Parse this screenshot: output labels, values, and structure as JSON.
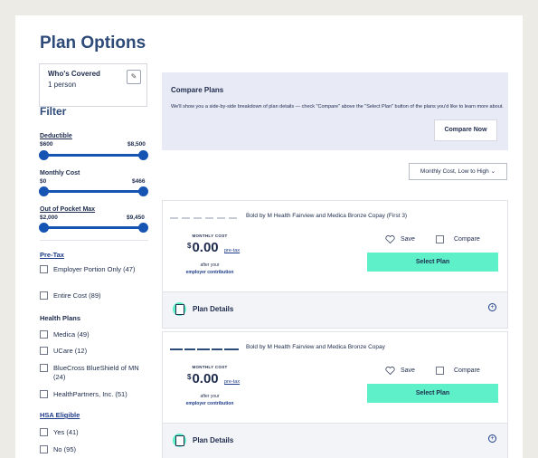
{
  "header": {
    "title": "Plan Options"
  },
  "covered": {
    "label": "Who's Covered",
    "value": "1 person",
    "edit_icon": "pencil-icon"
  },
  "filter": {
    "title": "Filter",
    "sliders": [
      {
        "label": "Deductible",
        "min": "$600",
        "max": "$8,500",
        "low_pct": 0,
        "high_pct": 100
      },
      {
        "label": "Monthly Cost",
        "min": "$0",
        "max": "$466",
        "low_pct": 0,
        "high_pct": 100
      },
      {
        "label": "Out of Pocket Max",
        "min": "$2,000",
        "max": "$9,450",
        "low_pct": 0,
        "high_pct": 100
      }
    ],
    "pretax": {
      "title": "Pre-Tax",
      "options": [
        "Employer Portion Only (47)",
        "Entire Cost (89)"
      ]
    },
    "health_plans": {
      "title": "Health Plans",
      "options": [
        "Medica (49)",
        "UCare (12)",
        "BlueCross BlueShield of MN (24)",
        "HealthPartners, Inc. (51)"
      ]
    },
    "hsa": {
      "title": "HSA Eligible",
      "options": [
        "Yes (41)",
        "No (95)"
      ]
    }
  },
  "compare": {
    "title": "Compare Plans",
    "desc": "We'll show you a side-by-side breakdown of plan details — check \"Compare\" above the \"Select Plan\" button of the plans you'd like to learn more about.",
    "button": "Compare Now"
  },
  "sort": {
    "value": "Monthly Cost, Low to High"
  },
  "plans": [
    {
      "name": "Bold by M Health Fairview and Medica Bronze Copay (First 3)",
      "monthly_label": "MONTHLY COST",
      "currency": "$",
      "price": "0.00",
      "pretax": "pre-tax",
      "after": "after your",
      "employer": "employer contribution",
      "save": "Save",
      "compare": "Compare",
      "select": "Select Plan",
      "details": "Plan Details"
    },
    {
      "name": "Bold by M Health Fairview and Medica Bronze Copay",
      "monthly_label": "MONTHLY COST",
      "currency": "$",
      "price": "0.00",
      "pretax": "pre-tax",
      "after": "after your",
      "employer": "employer contribution",
      "save": "Save",
      "compare": "Compare",
      "select": "Select Plan",
      "details": "Plan Details"
    }
  ],
  "colors": {
    "accent": "#5ef0c8",
    "primary": "#1554b3",
    "heading": "#2d4a78"
  }
}
